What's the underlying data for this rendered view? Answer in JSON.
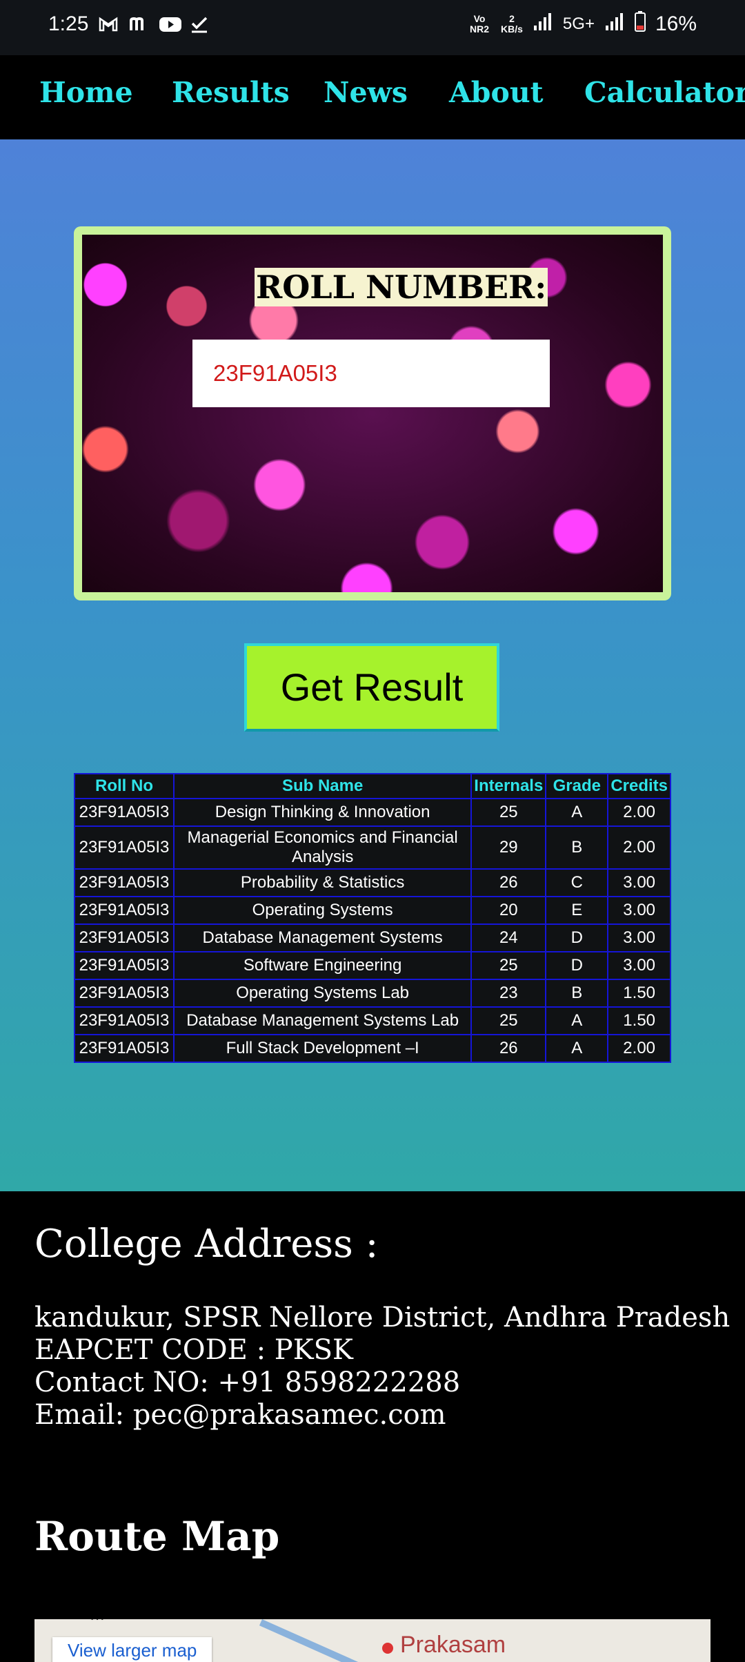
{
  "status_bar": {
    "time": "1:25",
    "net_speed_value": "2",
    "net_speed_unit": "KB/s",
    "network_label": "5G+",
    "volte_label": "Vo NR2",
    "battery": "16%"
  },
  "nav": {
    "items": [
      "Home",
      "Results",
      "News",
      "About",
      "Calculator"
    ]
  },
  "roll_form": {
    "title": "ROLL NUMBER:",
    "roll_value": "23F91A05I3",
    "submit_label": "Get Result"
  },
  "results_table": {
    "headers": [
      "Roll No",
      "Sub Name",
      "Internals",
      "Grade",
      "Credits"
    ],
    "rows": [
      [
        "23F91A05I3",
        "Design Thinking & Innovation",
        "25",
        "A",
        "2.00"
      ],
      [
        "23F91A05I3",
        "Managerial Economics and Financial Analysis",
        "29",
        "B",
        "2.00"
      ],
      [
        "23F91A05I3",
        "Probability & Statistics",
        "26",
        "C",
        "3.00"
      ],
      [
        "23F91A05I3",
        "Operating Systems",
        "20",
        "E",
        "3.00"
      ],
      [
        "23F91A05I3",
        "Database Management Systems",
        "24",
        "D",
        "3.00"
      ],
      [
        "23F91A05I3",
        "Software Engineering",
        "25",
        "D",
        "3.00"
      ],
      [
        "23F91A05I3",
        "Operating Systems Lab",
        "23",
        "B",
        "1.50"
      ],
      [
        "23F91A05I3",
        "Database Management Systems Lab",
        "25",
        "A",
        "1.50"
      ],
      [
        "23F91A05I3",
        "Full Stack Development –I",
        "26",
        "A",
        "2.00"
      ]
    ]
  },
  "footer": {
    "address_title": "College Address :",
    "address_line": "kandukur, SPSR Nellore District, Andhra Pradesh",
    "eapcet_line": "EAPCET CODE : PKSK",
    "contact_line": "Contact NO: +91 8598222288",
    "email_line": "Email: pec@prakasamec.com",
    "route_title": "Route Map",
    "map_link": "View larger map",
    "map_place": "Prakasam"
  },
  "colors": {
    "nav_text": "#2fe3e8",
    "button_bg": "#a6f22c",
    "card_border": "#c9f39a",
    "table_border": "#1515d8",
    "input_text": "#d11a1a"
  }
}
